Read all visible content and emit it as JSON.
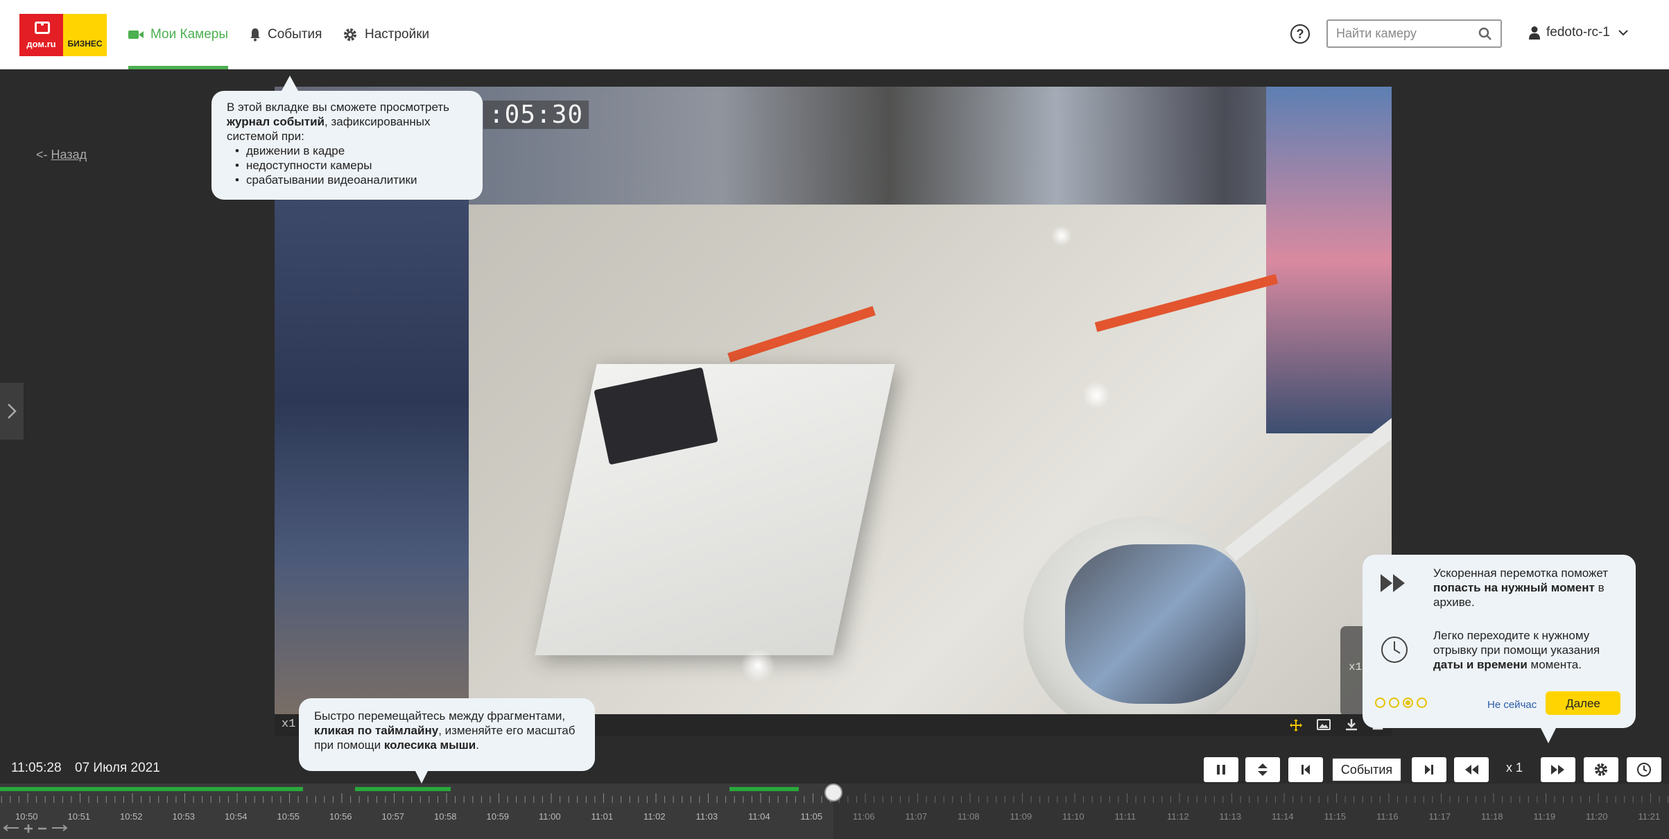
{
  "logo": {
    "left_text": "дом.ru",
    "right_text": "БИЗНЕС"
  },
  "nav": {
    "cameras": "Мои Камеры",
    "events": "События",
    "settings": "Настройки"
  },
  "header": {
    "search_placeholder": "Найти камеру",
    "help": "?",
    "username": "fedoto-rc-1"
  },
  "back": {
    "arrow": "<-",
    "label": "Назад"
  },
  "video": {
    "osd_time": ":05:30",
    "scale_label": "x1",
    "overlay_label": "x1"
  },
  "controls": {
    "time": "11:05:28",
    "date": "07 Июля 2021",
    "events_button": "События",
    "speed": "x 1"
  },
  "timeline": {
    "labels": [
      "10:50",
      "10:51",
      "10:52",
      "10:53",
      "10:54",
      "10:55",
      "10:56",
      "10:57",
      "10:58",
      "10:59",
      "11:00",
      "11:01",
      "11:02",
      "11:03",
      "11:04",
      "11:05",
      "11:06",
      "11:07",
      "11:08",
      "11:09",
      "11:10",
      "11:11",
      "11:12",
      "11:13",
      "11:14",
      "11:15",
      "11:16",
      "11:17",
      "11:18",
      "11:19",
      "11:20",
      "11:21"
    ]
  },
  "tip_events": {
    "line1": "В этой вкладке вы сможете просмотреть",
    "bold": "журнал  событий",
    "line2": ", зафиксированных",
    "line3": "системой при:",
    "items": [
      "движении в кадре",
      "недоступности камеры",
      "срабатывании видеоаналитики"
    ]
  },
  "tip_timeline": {
    "line1": "Быстро перемещайтесь между фрагментами,",
    "bold1": "кликая по таймлайну",
    "line2": ", изменяйте его масштаб",
    "line3": "при помощи ",
    "bold2": "колесика мыши",
    "end": "."
  },
  "tip_playback": {
    "p1_a": "Ускоренная перемотка поможет ",
    "p1_bold": "попасть на нужный момент",
    "p1_b": " в архиве.",
    "p2_a": "Легко переходите к нужному отрывку при помощи указания ",
    "p2_bold": "даты и времени",
    "p2_b": " момента.",
    "not_now": "Не сейчас",
    "next": "Далее",
    "step": 3,
    "steps_total": 4
  },
  "colors": {
    "accent_green": "#4caf50",
    "timeline_green": "#29a83a",
    "brand_red": "#e31e24",
    "brand_yellow": "#ffd400"
  }
}
